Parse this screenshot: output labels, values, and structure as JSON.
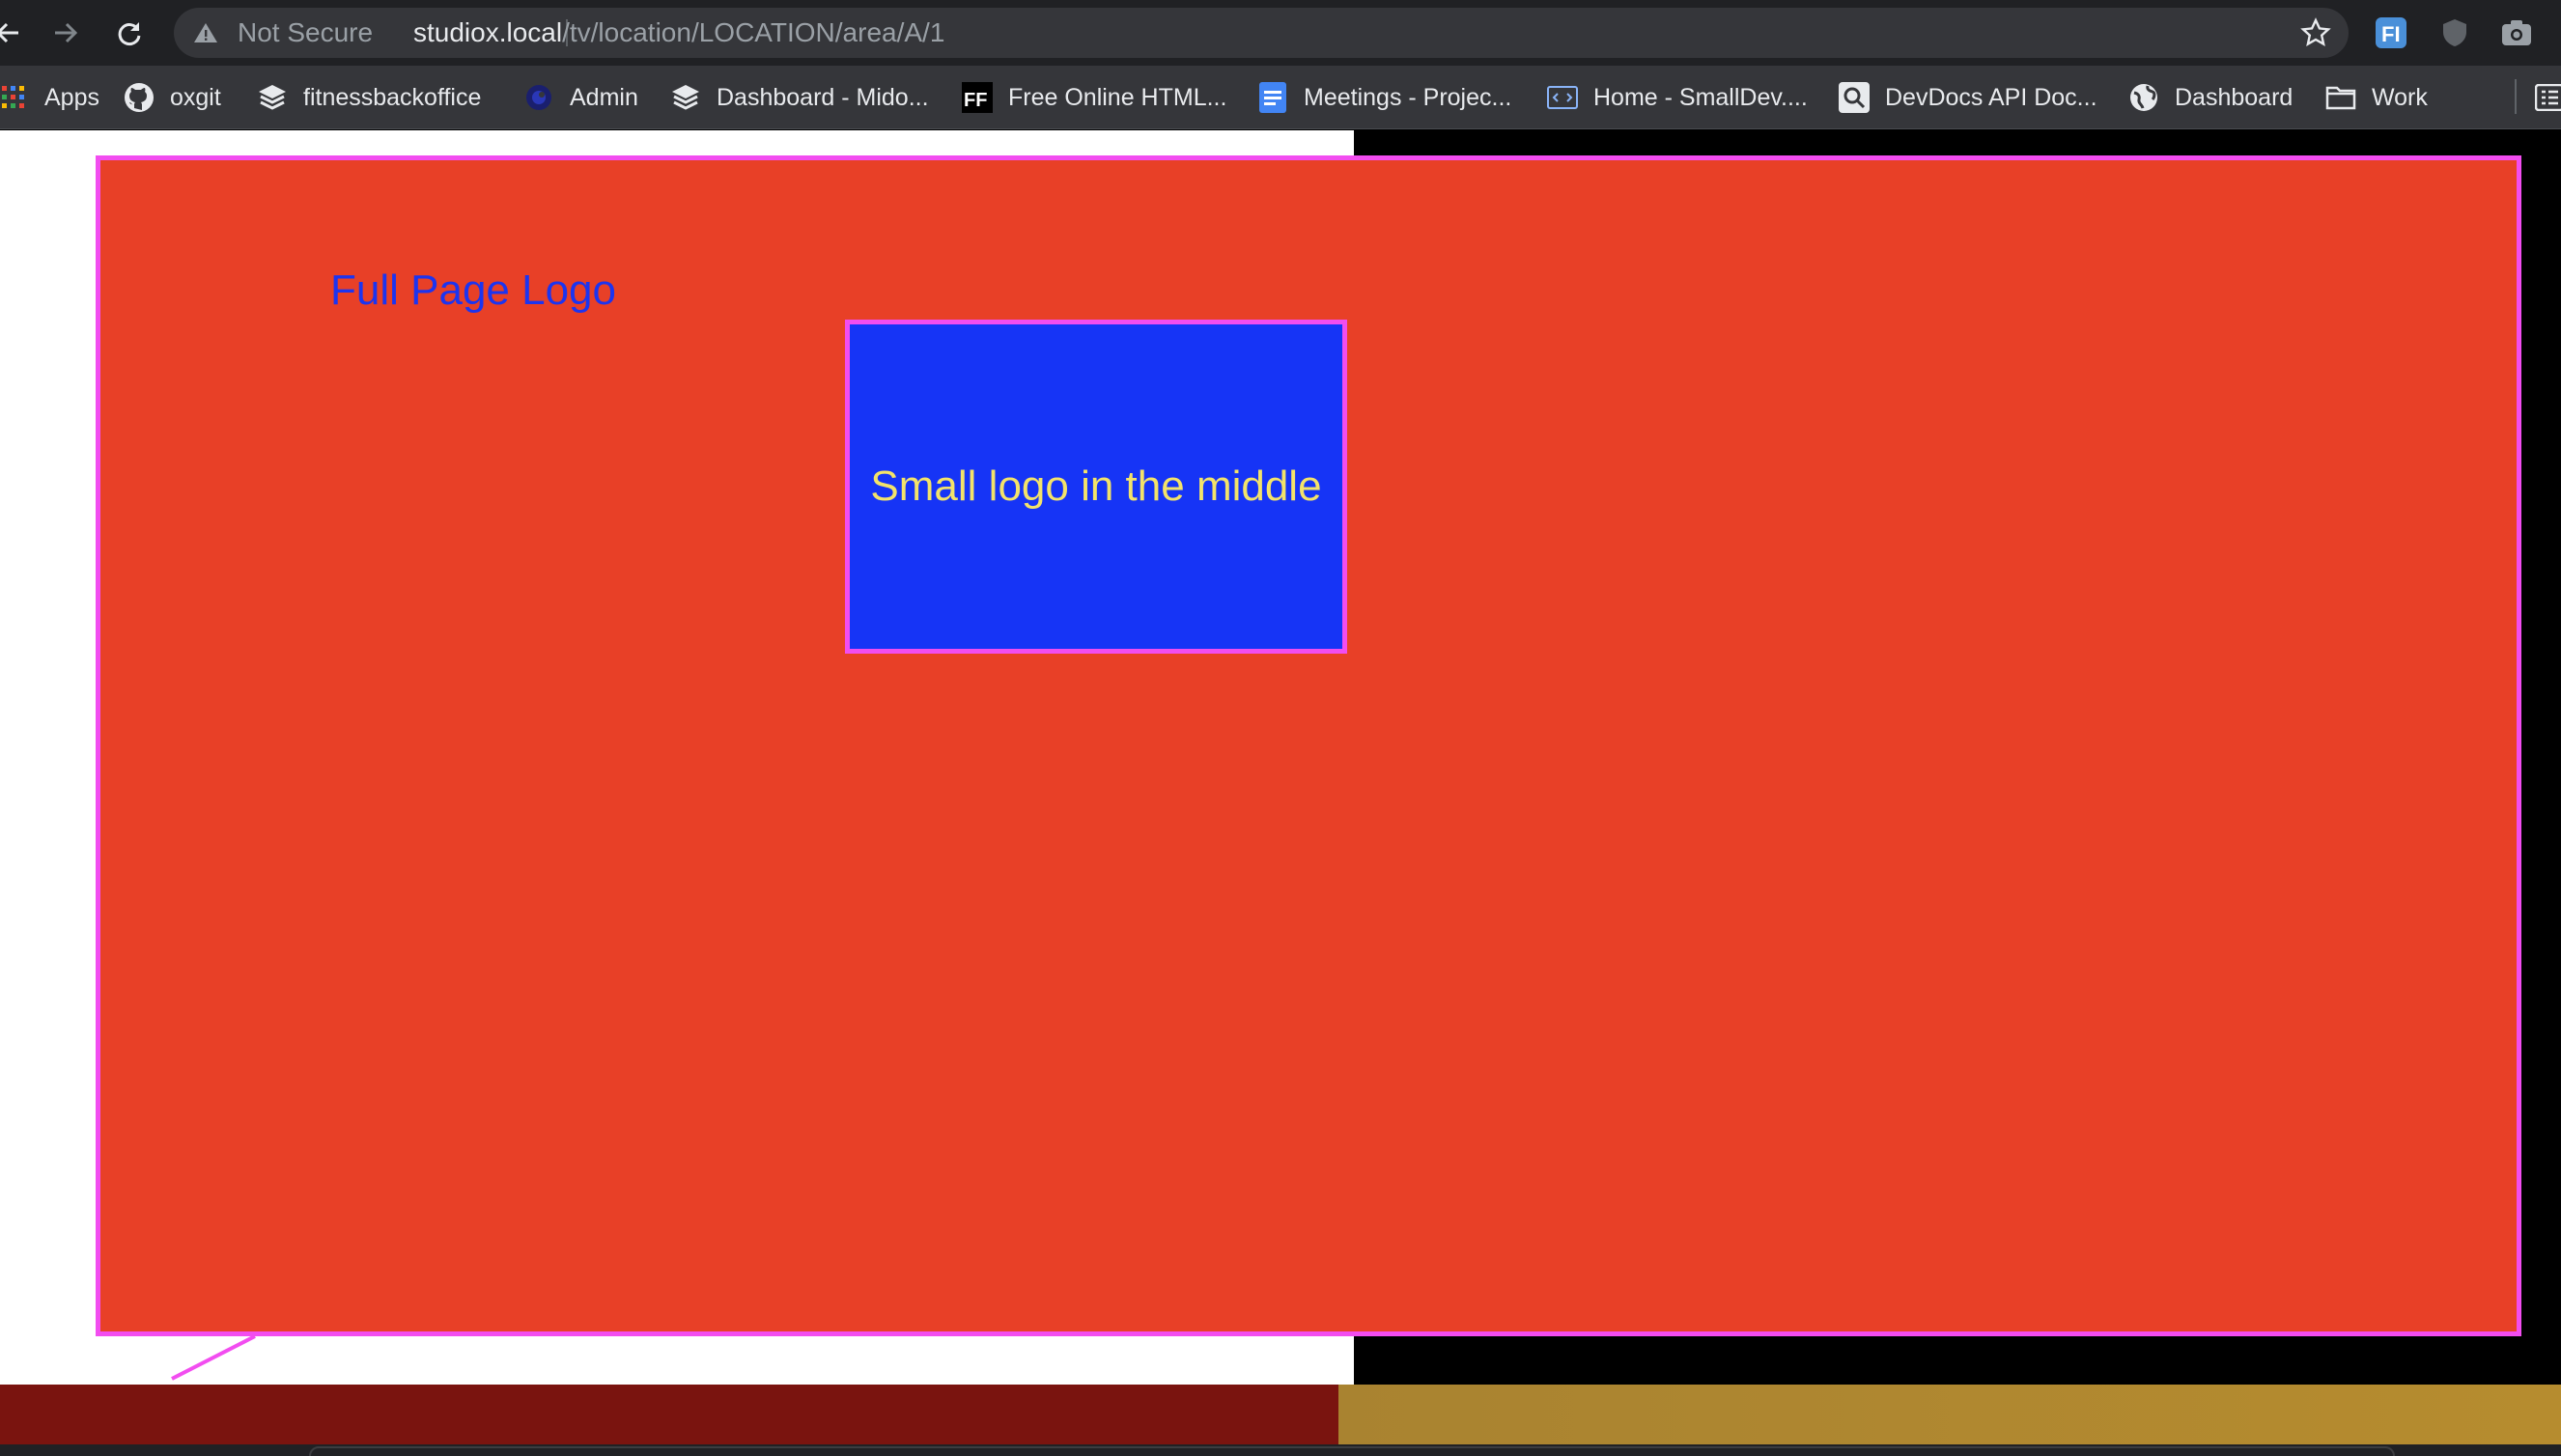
{
  "browser": {
    "security_label": "Not Secure",
    "url_host": "studiox.local",
    "url_path": "/tv/location/LOCATION/area/A/1",
    "extensions": [
      "fi-extension-icon",
      "shield-extension-icon",
      "camera-extension-icon"
    ]
  },
  "bookmarks": [
    {
      "label": "Apps",
      "icon": "apps-grid-icon"
    },
    {
      "label": "oxgit",
      "icon": "github-icon"
    },
    {
      "label": "fitnessbackoffice",
      "icon": "layers-icon"
    },
    {
      "label": "Admin",
      "icon": "admin-icon"
    },
    {
      "label": "Dashboard - Mido...",
      "icon": "layers-icon"
    },
    {
      "label": "Free Online HTML...",
      "icon": "ff-icon"
    },
    {
      "label": "Meetings - Projec...",
      "icon": "docs-icon"
    },
    {
      "label": "Home - SmallDev....",
      "icon": "code-icon"
    },
    {
      "label": "DevDocs API Doc...",
      "icon": "search-icon"
    },
    {
      "label": "Dashboard",
      "icon": "globe-icon"
    },
    {
      "label": "Work",
      "icon": "folder-icon"
    }
  ],
  "page": {
    "full_logo_label": "Full Page Logo",
    "small_logo_label": "Small logo in the middle"
  },
  "colors": {
    "full_logo_bg": "#e84027",
    "small_logo_bg": "#1634f6",
    "outline": "#f24df0",
    "full_logo_text": "#1c34f0",
    "small_logo_text": "#f3e36a"
  }
}
